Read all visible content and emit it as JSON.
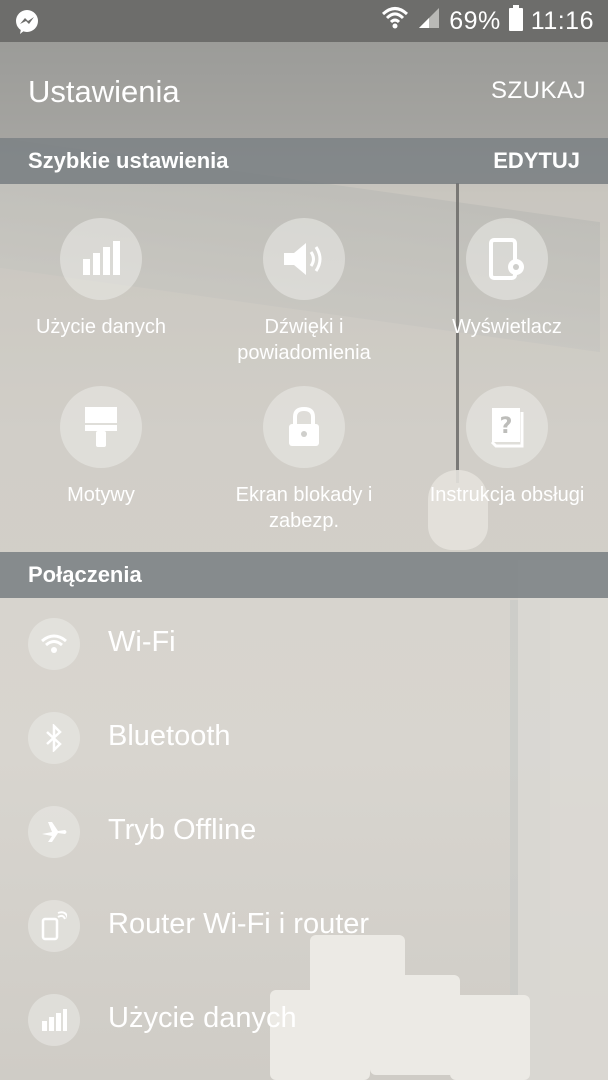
{
  "status_bar": {
    "battery_percent": "69%",
    "time": "11:16",
    "icons": [
      "messenger-icon",
      "wifi-icon",
      "signal-icon",
      "battery-icon"
    ]
  },
  "app_bar": {
    "title": "Ustawienia",
    "search_label": "SZUKAJ"
  },
  "quick_settings": {
    "header": "Szybkie ustawienia",
    "edit_label": "EDYTUJ",
    "items": [
      {
        "label": "Użycie danych",
        "icon": "data-usage-icon"
      },
      {
        "label": "Dźwięki i powiadomienia",
        "icon": "speaker-icon"
      },
      {
        "label": "Wyświetlacz",
        "icon": "display-settings-icon"
      },
      {
        "label": "Motywy",
        "icon": "paintbrush-icon"
      },
      {
        "label": "Ekran blokady i zabezp.",
        "icon": "lock-icon"
      },
      {
        "label": "Instrukcja obsługi",
        "icon": "help-book-icon"
      }
    ]
  },
  "connections": {
    "header": "Połączenia",
    "items": [
      {
        "label": "Wi-Fi",
        "icon": "wifi-icon"
      },
      {
        "label": "Bluetooth",
        "icon": "bluetooth-icon"
      },
      {
        "label": "Tryb Offline",
        "icon": "airplane-icon"
      },
      {
        "label": "Router Wi-Fi i router",
        "icon": "hotspot-icon"
      },
      {
        "label": "Użycie danych",
        "icon": "data-usage-icon"
      }
    ]
  },
  "colors": {
    "status_bar": "#6d6d6b",
    "section_header": "#787e81",
    "text": "#ffffff"
  }
}
